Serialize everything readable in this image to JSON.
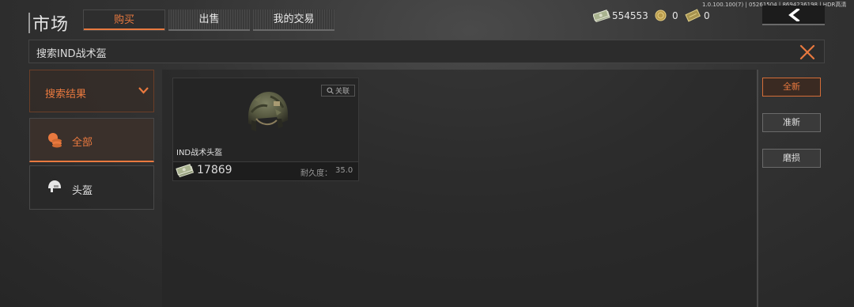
{
  "version_text": "1.0.100.100(7) | 05261504 | 8694236198 | HDR高清",
  "header": {
    "title": "市场",
    "tabs": [
      {
        "label": "购买",
        "active": true
      },
      {
        "label": "出售",
        "active": false
      },
      {
        "label": "我的交易",
        "active": false
      }
    ]
  },
  "currency": {
    "cash": "554553",
    "coins": "0",
    "bonds": "0"
  },
  "search": {
    "query": "搜索IND战术盔"
  },
  "categories": {
    "header_label": "搜索结果",
    "items": [
      {
        "label": "全部",
        "icon": "coins-stack-icon",
        "active": true
      },
      {
        "label": "头盔",
        "icon": "helmet-icon",
        "active": false
      }
    ]
  },
  "items": [
    {
      "name": "IND战术头盔",
      "related_label": "关联",
      "price": "17869",
      "durability_label": "耐久度：",
      "durability_value": "35.0"
    }
  ],
  "filters": [
    {
      "label": "全新",
      "active": true
    },
    {
      "label": "准新",
      "active": false
    },
    {
      "label": "磨损",
      "active": false
    }
  ],
  "colors": {
    "accent": "#e9793f",
    "background": "#2e2e2e"
  }
}
